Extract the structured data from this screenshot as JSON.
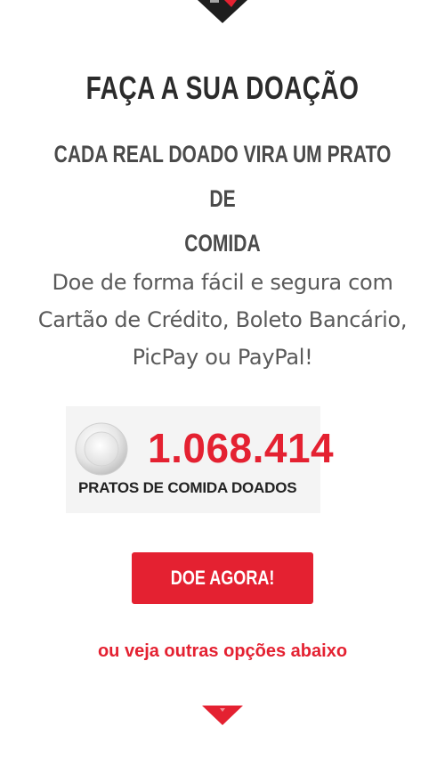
{
  "header": {
    "title": "FAÇA A SUA DOAÇÃO",
    "subtitle_line1": "CADA REAL DOADO VIRA UM PRATO DE",
    "subtitle_line2": "COMIDA"
  },
  "description": {
    "line1": "Doe de forma fácil e segura com",
    "line2": "Cartão de Crédito, Boleto Bancário,",
    "line3": "PicPay ou PayPal!"
  },
  "counter": {
    "value": "1.068.414",
    "label": "PRATOS DE COMIDA DOADOS",
    "icon": "plate-icon"
  },
  "actions": {
    "donate_label": "DOE AGORA!",
    "other_options_label": "ou veja outras opções abaixo"
  },
  "icons": {
    "top": "chevron-down-icon",
    "bottom": "chevron-down-icon"
  },
  "colors": {
    "accent": "#e42131",
    "heading": "#2b2b2b",
    "text": "#5a5a5a",
    "card_background": "#f4f4f4"
  }
}
